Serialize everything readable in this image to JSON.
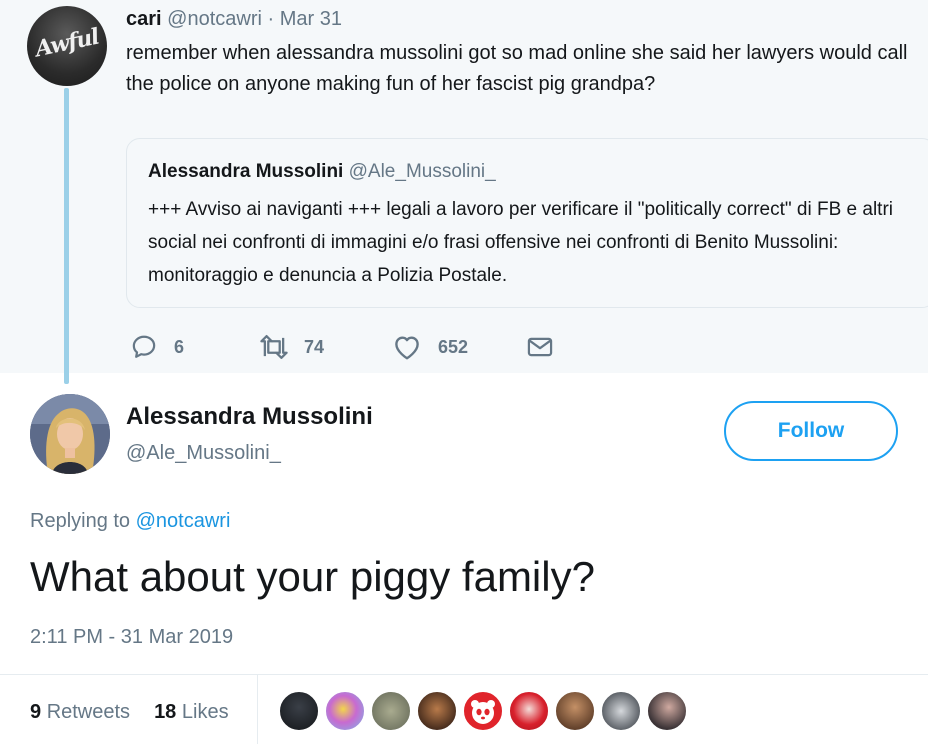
{
  "parent_tweet": {
    "name": "cari",
    "handle": "@notcawri",
    "separator": "·",
    "date": "Mar 31",
    "avatar_text": "Awful",
    "text": "remember when alessandra mussolini got so mad online she said her lawyers would call the police on anyone making fun of her fascist pig grandpa?",
    "quote": {
      "name": "Alessandra Mussolini",
      "handle": "@Ale_Mussolini_",
      "text": "+++ Avviso ai naviganti +++ legali a lavoro per verificare il \"politically correct\" di FB e altri social nei confronti di immagini e/o frasi offensive nei confronti di Benito Mussolini: monitoraggio e denuncia a Polizia Postale."
    },
    "actions": {
      "reply_count": "6",
      "retweet_count": "74",
      "like_count": "652",
      "icons": [
        "reply-icon",
        "retweet-icon",
        "like-icon",
        "direct-message-icon"
      ]
    }
  },
  "main_tweet": {
    "name": "Alessandra Mussolini",
    "handle": "@Ale_Mussolini_",
    "follow_label": "Follow",
    "replying_prefix": "Replying to",
    "replying_to": "@notcawri",
    "text": "What about your piggy family?",
    "timestamp": "2:11 PM - 31 Mar 2019",
    "stats": {
      "retweets_count": "9",
      "retweets_label": "Retweets",
      "likes_count": "18",
      "likes_label": "Likes"
    },
    "liker_avatar_count": 9
  },
  "colors": {
    "accent": "#1da1f2",
    "mention": "#1b95e0",
    "muted_text": "#657786",
    "primary_text": "#14171a",
    "parent_background": "#f5f8fa",
    "thread_line": "#9bd0e8"
  }
}
